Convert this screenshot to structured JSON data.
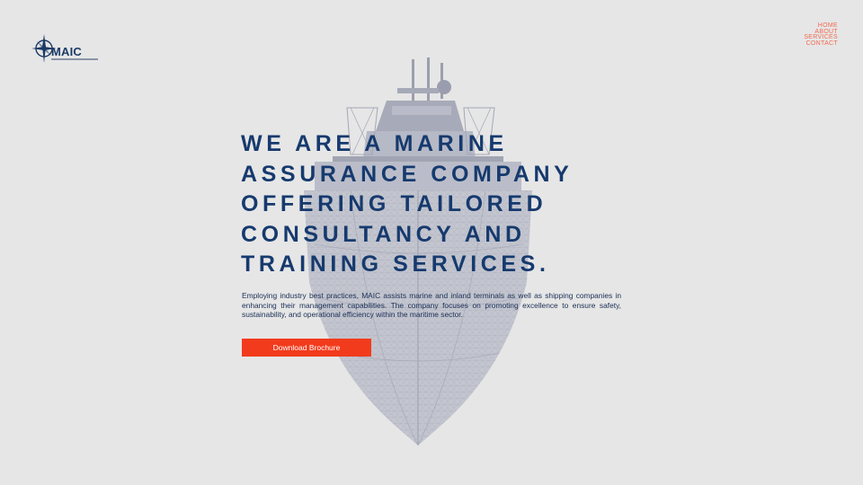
{
  "brand": {
    "name": "MAIC",
    "colors": {
      "navy": "#163a6e",
      "accent": "#f23b1c",
      "nav_link": "#f26a52",
      "background": "#e6e6e6"
    },
    "logo_icon": "compass-star-icon"
  },
  "nav": {
    "items": [
      {
        "label": "HOME"
      },
      {
        "label": "ABOUT"
      },
      {
        "label": "SERVICES"
      },
      {
        "label": "CONTACT"
      }
    ]
  },
  "hero": {
    "headline_lines": [
      "WE ARE A MARINE",
      "ASSURANCE COMPANY",
      "OFFERING TAILORED",
      "CONSULTANCY AND",
      "TRAINING SERVICES."
    ],
    "intro": "Employing industry best practices, MAIC assists marine and inland terminals as well as shipping companies in enhancing their management capabilities. The company focuses on promoting excellence to ensure safety, sustainability, and operational efficiency within the maritime sector.",
    "cta_label": "Download Brochure",
    "background_image": "ship-wireframe-illustration"
  }
}
